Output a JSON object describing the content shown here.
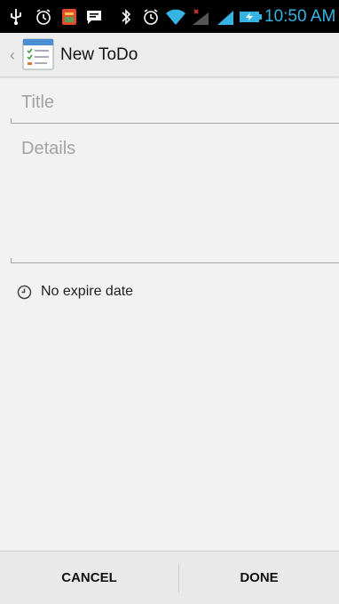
{
  "status_bar": {
    "time": "10:50 AM",
    "icons": [
      "usb-icon",
      "alarm-icon",
      "app-notification-icon",
      "chat-icon",
      "bluetooth-icon",
      "alarm-clock-icon",
      "wifi-icon",
      "signal-no-sim-icon",
      "signal-icon",
      "battery-charging-icon"
    ],
    "time_color": "#36b3e3"
  },
  "action_bar": {
    "title": "New ToDo"
  },
  "form": {
    "title_placeholder": "Title",
    "details_placeholder": "Details",
    "expire_label": "No expire date"
  },
  "buttons": {
    "cancel": "CANCEL",
    "done": "DONE"
  }
}
